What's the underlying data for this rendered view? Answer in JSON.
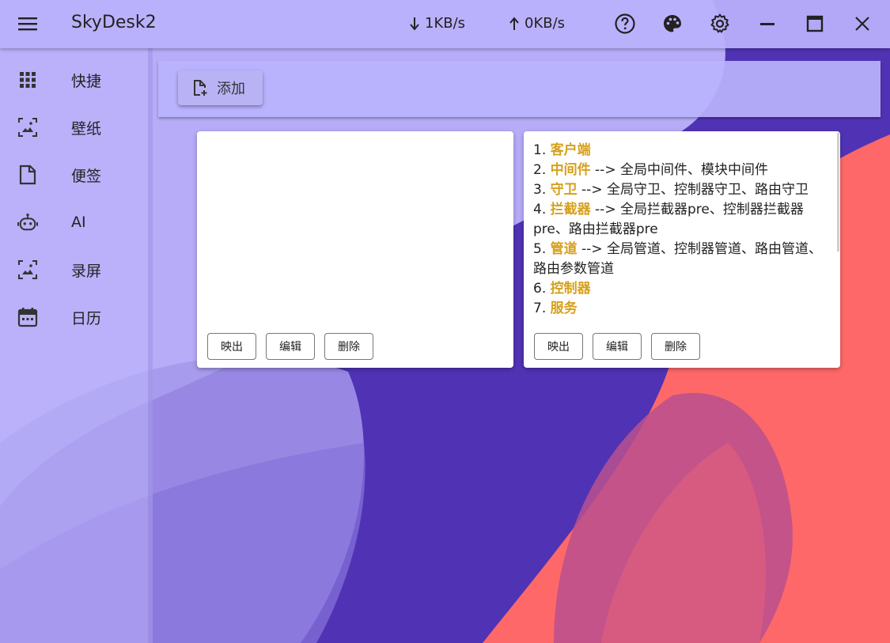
{
  "app": {
    "title": "SkyDesk2"
  },
  "header": {
    "download_speed": "1KB/s",
    "upload_speed": "0KB/s"
  },
  "sidebar": {
    "items": [
      {
        "label": "快捷",
        "icon": "grid-icon"
      },
      {
        "label": "壁纸",
        "icon": "wallpaper-icon"
      },
      {
        "label": "便签",
        "icon": "note-icon"
      },
      {
        "label": "AI",
        "icon": "robot-icon"
      },
      {
        "label": "录屏",
        "icon": "screen-record-icon"
      },
      {
        "label": "日历",
        "icon": "calendar-icon"
      }
    ]
  },
  "toolbar": {
    "add_label": "添加"
  },
  "cards": [
    {
      "lines": [],
      "buttons": {
        "export": "映出",
        "edit": "编辑",
        "delete": "删除"
      }
    },
    {
      "lines": [
        {
          "num": "1.",
          "kw": "客户端",
          "rest": ""
        },
        {
          "num": "2.",
          "kw": "中间件",
          "rest": " --> 全局中间件、模块中间件"
        },
        {
          "num": "3.",
          "kw": "守卫",
          "rest": " --> 全局守卫、控制器守卫、路由守卫"
        },
        {
          "num": "4.",
          "kw": "拦截器",
          "rest": " --> 全局拦截器pre、控制器拦截器pre、路由拦截器pre"
        },
        {
          "num": "5.",
          "kw": "管道",
          "rest": " --> 全局管道、控制器管道、路由管道、路由参数管道"
        },
        {
          "num": "6.",
          "kw": "控制器",
          "rest": ""
        },
        {
          "num": "7.",
          "kw": "服务",
          "rest": ""
        }
      ],
      "buttons": {
        "export": "映出",
        "edit": "编辑",
        "delete": "删除"
      }
    }
  ],
  "colors": {
    "background": "#5033b4",
    "header": "#bab2fc",
    "accent_shape": "#ff6868",
    "keyword": "#d6a01c"
  }
}
